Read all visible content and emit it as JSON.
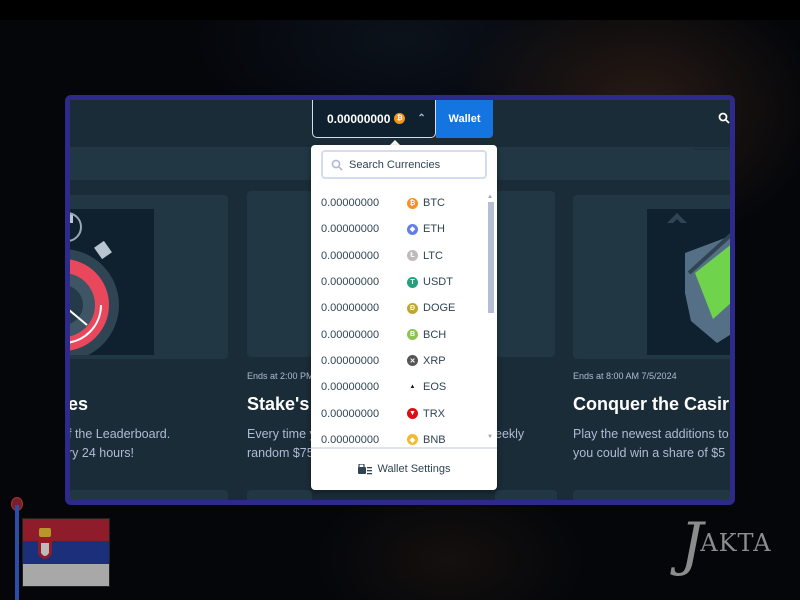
{
  "header": {
    "balance": "0.00000000",
    "balance_currency_icon": "btc-coin-icon",
    "wallet_label": "Wallet",
    "search_icon": "search-icon"
  },
  "currency_dropdown": {
    "search_placeholder": "Search Currencies",
    "currencies": [
      {
        "amount": "0.00000000",
        "code": "BTC",
        "icon": "btc-coin-icon",
        "color": "#f7931a",
        "glyph": "₿"
      },
      {
        "amount": "0.00000000",
        "code": "ETH",
        "icon": "eth-coin-icon",
        "color": "#627eea",
        "glyph": "◆"
      },
      {
        "amount": "0.00000000",
        "code": "LTC",
        "icon": "ltc-coin-icon",
        "color": "#bfbbbb",
        "glyph": "Ł"
      },
      {
        "amount": "0.00000000",
        "code": "USDT",
        "icon": "usdt-coin-icon",
        "color": "#26a17b",
        "glyph": "T"
      },
      {
        "amount": "0.00000000",
        "code": "DOGE",
        "icon": "doge-coin-icon",
        "color": "#c2a633",
        "glyph": "Ð"
      },
      {
        "amount": "0.00000000",
        "code": "BCH",
        "icon": "bch-coin-icon",
        "color": "#8dc351",
        "glyph": "B"
      },
      {
        "amount": "0.00000000",
        "code": "XRP",
        "icon": "xrp-coin-icon",
        "color": "#555555",
        "glyph": "✕"
      },
      {
        "amount": "0.00000000",
        "code": "EOS",
        "icon": "eos-coin-icon",
        "color": "#ffffff",
        "glyph": "▲"
      },
      {
        "amount": "0.00000000",
        "code": "TRX",
        "icon": "trx-coin-icon",
        "color": "#e50915",
        "glyph": "▼"
      },
      {
        "amount": "0.00000000",
        "code": "BNB",
        "icon": "bnb-coin-icon",
        "color": "#f3ba2f",
        "glyph": "◆"
      }
    ],
    "wallet_settings_label": "Wallet Settings"
  },
  "promotions": [
    {
      "meta": "",
      "title": "es",
      "desc_line1": "f the Leaderboard.",
      "desc_line2": "ry 24 hours!"
    },
    {
      "meta": "Ends at 2:00 PM",
      "title": "Stake's",
      "desc_line1": "Every time y",
      "desc_line2": "random $75"
    },
    {
      "meta": "",
      "title": "",
      "desc_line1": "eekly",
      "desc_line2": ""
    },
    {
      "meta": "Ends at 8:00 AM 7/5/2024",
      "title": "Conquer the Casir",
      "desc_line1": "Play the newest additions to",
      "desc_line2": "you could win a share of $5"
    }
  ],
  "overlay": {
    "logo_text_big": "J",
    "logo_text_rest": "AKTA",
    "flag": "serbia-flag"
  },
  "colors": {
    "accent": "#1475e1",
    "frame_border": "#2e2a8c",
    "panel_bg": "#1a2c38",
    "card_bg": "#213743"
  }
}
